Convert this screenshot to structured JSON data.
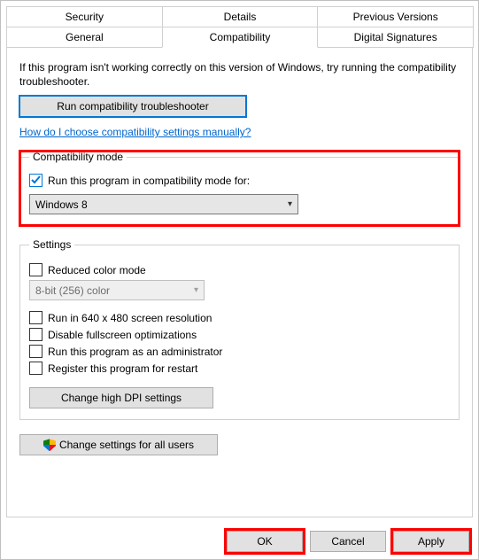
{
  "tabs": {
    "row1": [
      "Security",
      "Details",
      "Previous Versions"
    ],
    "row2": [
      "General",
      "Compatibility",
      "Digital Signatures"
    ],
    "active": "Compatibility"
  },
  "intro": "If this program isn't working correctly on this version of Windows, try running the compatibility troubleshooter.",
  "run_troubleshooter": "Run compatibility troubleshooter",
  "help_link": "How do I choose compatibility settings manually?",
  "compat_mode": {
    "legend": "Compatibility mode",
    "checkbox_label": "Run this program in compatibility mode for:",
    "checkbox_checked": true,
    "selected_os": "Windows 8"
  },
  "settings": {
    "legend": "Settings",
    "reduced_color": {
      "label": "Reduced color mode",
      "checked": false
    },
    "color_depth": "8-bit (256) color",
    "run_640": {
      "label": "Run in 640 x 480 screen resolution",
      "checked": false
    },
    "disable_fullscreen": {
      "label": "Disable fullscreen optimizations",
      "checked": false
    },
    "run_admin": {
      "label": "Run this program as an administrator",
      "checked": false
    },
    "register_restart": {
      "label": "Register this program for restart",
      "checked": false
    },
    "dpi_button": "Change high DPI settings"
  },
  "all_users_button": "Change settings for all users",
  "footer": {
    "ok": "OK",
    "cancel": "Cancel",
    "apply": "Apply"
  }
}
